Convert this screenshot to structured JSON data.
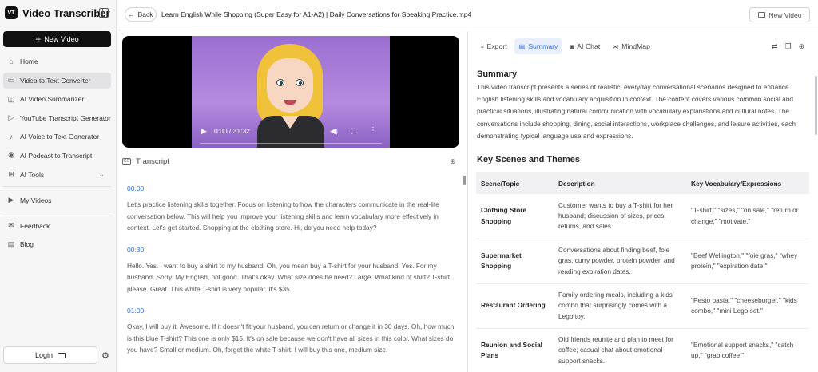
{
  "app": {
    "name": "Video Transcriber",
    "logo_text": "VT"
  },
  "sidebar": {
    "new_video_label": "New Video",
    "items": [
      {
        "label": "Home",
        "icon": "home-icon",
        "glyph": "⌂",
        "active": false
      },
      {
        "label": "Video to Text Converter",
        "icon": "video-icon",
        "glyph": "▭",
        "active": true
      },
      {
        "label": "AI Video Summarizer",
        "icon": "ai-icon",
        "glyph": "◫",
        "active": false
      },
      {
        "label": "YouTube Transcript Generator",
        "icon": "youtube-icon",
        "glyph": "▷",
        "active": false
      },
      {
        "label": "AI Voice to Text Generator",
        "icon": "microphone-icon",
        "glyph": "♪",
        "active": false
      },
      {
        "label": "AI Podcast to Transcript",
        "icon": "podcast-icon",
        "glyph": "◉",
        "active": false
      },
      {
        "label": "AI Tools",
        "icon": "tools-icon",
        "glyph": "⊞",
        "active": false
      },
      {
        "label": "My Videos",
        "icon": "my-videos-icon",
        "glyph": "▶",
        "active": false
      },
      {
        "label": "Feedback",
        "icon": "feedback-icon",
        "glyph": "✉",
        "active": false
      },
      {
        "label": "Blog",
        "icon": "blog-icon",
        "glyph": "▤",
        "active": false
      }
    ],
    "login_label": "Login"
  },
  "topbar": {
    "back_label": "Back",
    "file_title": "Learn English While Shopping (Super Easy for A1-A2) | Daily Conversations for Speaking Practice.mp4",
    "new_video_label": "New Video"
  },
  "player": {
    "time": "0:00 / 31:32",
    "progress": 0
  },
  "transcript": {
    "header": "Transcript",
    "segments": [
      {
        "time": "00:00",
        "text": "Let's practice listening skills together. Focus on listening to how the characters communicate in the real-life conversation below. This will help you improve your listening skills and learn vocabulary more effectively in context. Let's get started. Shopping at the clothing store. Hi, do you need help today?"
      },
      {
        "time": "00:30",
        "text": "Hello. Yes. I want to buy a shirt to my husband. Oh, you mean buy a T-shirt for your husband. Yes. For my husband. Sorry. My English, not good. That's okay. What size does he need? Large. What kind of shirt? T-shirt, please. Great. This white T-shirt is very popular. It's $35."
      },
      {
        "time": "01:00",
        "text": "Okay, I will buy it. Awesome. If it doesn't fit your husband, you can return or change it in 30 days. Oh, how much is this blue T-shirt? This one is only $15. It's on sale because we don't have all sizes in this color. What sizes do you have? Small or medium. Oh, forget the white T-shirt. I will buy this one, medium size."
      }
    ]
  },
  "tabs": [
    {
      "label": "Export",
      "icon": "export-icon",
      "glyph": "⤓",
      "active": false
    },
    {
      "label": "Summary",
      "icon": "summary-icon",
      "glyph": "▤",
      "active": true
    },
    {
      "label": "AI Chat",
      "icon": "ai-chat-icon",
      "glyph": "◙",
      "active": false
    },
    {
      "label": "MindMap",
      "icon": "mindmap-icon",
      "glyph": "⋈",
      "active": false
    }
  ],
  "summary": {
    "title": "Summary",
    "text": "This video transcript presents a series of realistic, everyday conversational scenarios designed to enhance English listening skills and vocabulary acquisition in context. The content covers various common social and practical situations, illustrating natural communication with vocabulary explanations and cultural notes. The conversations include shopping, dining, social interactions, workplace challenges, and leisure activities, each demonstrating typical language use and expressions."
  },
  "themes": {
    "title": "Key Scenes and Themes",
    "columns": [
      "Scene/Topic",
      "Description",
      "Key Vocabulary/Expressions"
    ],
    "rows": [
      [
        "Clothing Store Shopping",
        "Customer wants to buy a T-shirt for her husband; discussion of sizes, prices, returns, and sales.",
        "\"T-shirt,\" \"sizes,\" \"on sale,\" \"return or change,\" \"motivate.\""
      ],
      [
        "Supermarket Shopping",
        "Conversations about finding beef, foie gras, curry powder, protein powder, and reading expiration dates.",
        "\"Beef Wellington,\" \"foie gras,\" \"whey protein,\" \"expiration date.\""
      ],
      [
        "Restaurant Ordering",
        "Family ordering meals, including a kids' combo that surprisingly comes with a Lego toy.",
        "\"Pesto pasta,\" \"cheeseburger,\" \"kids combo,\" \"mini Lego set.\""
      ],
      [
        "Reunion and Social Plans",
        "Old friends reunite and plan to meet for coffee; casual chat about emotional support snacks.",
        "\"Emotional support snacks,\" \"catch up,\" \"grab coffee.\""
      ]
    ]
  }
}
